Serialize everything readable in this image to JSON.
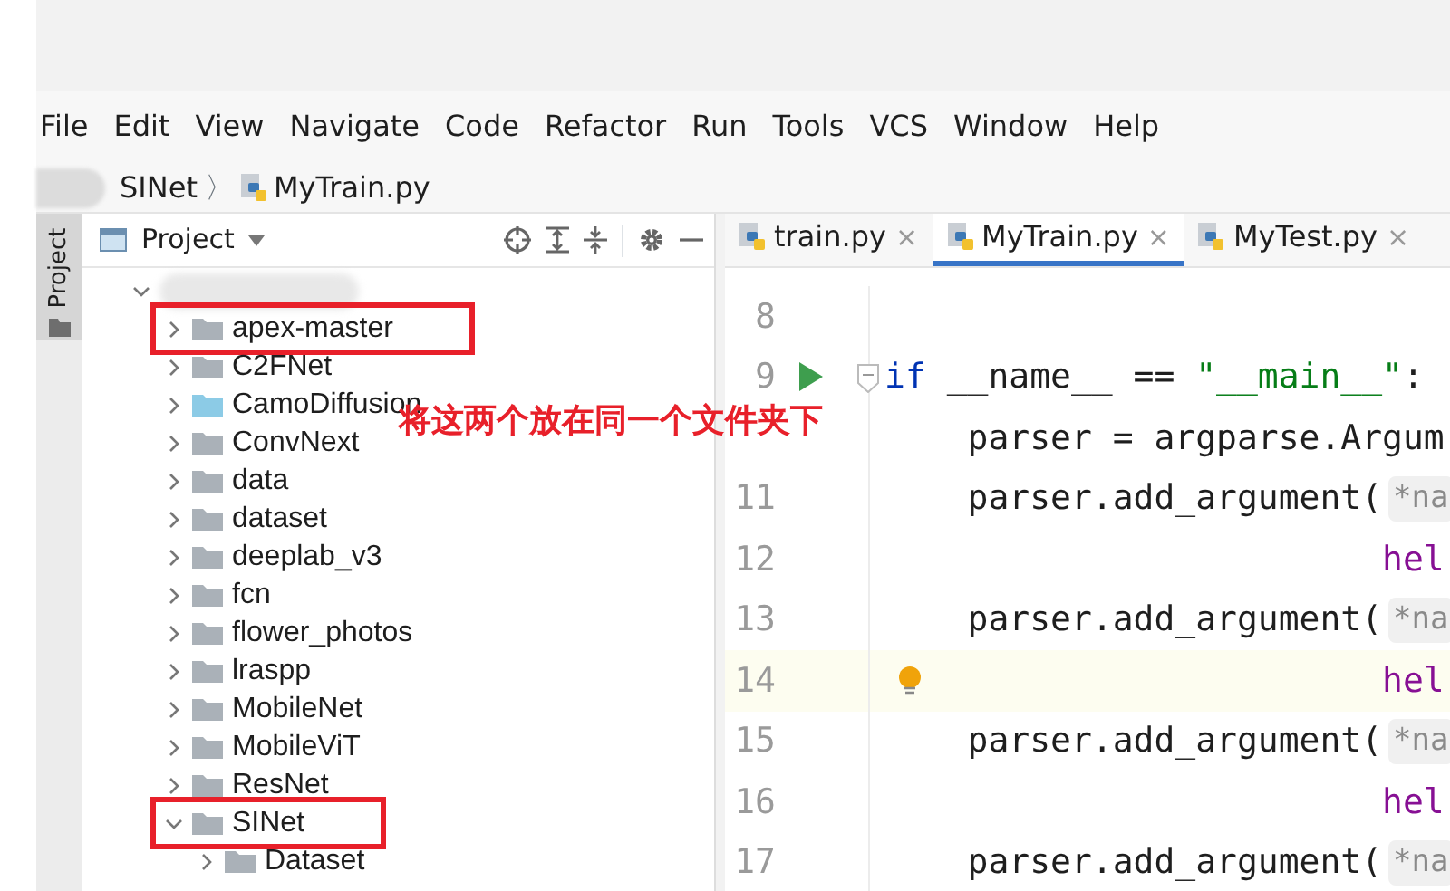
{
  "menu": [
    "File",
    "Edit",
    "View",
    "Navigate",
    "Code",
    "Refactor",
    "Run",
    "Tools",
    "VCS",
    "Window",
    "Help"
  ],
  "breadcrumb": {
    "folder": "SINet",
    "separator": "〉",
    "file": "MyTrain.py"
  },
  "side_strip": {
    "label": "Project"
  },
  "project_panel": {
    "title": "Project",
    "tree": {
      "expanded": true,
      "children": [
        {
          "name": "apex-master",
          "kind": "folder",
          "expanded": false,
          "highlighted": true
        },
        {
          "name": "C2FNet",
          "kind": "folder",
          "expanded": false,
          "highlighted": false
        },
        {
          "name": "CamoDiffusion",
          "kind": "source",
          "expanded": false,
          "highlighted": false
        },
        {
          "name": "ConvNext",
          "kind": "folder",
          "expanded": false,
          "highlighted": false
        },
        {
          "name": "data",
          "kind": "folder",
          "expanded": false,
          "highlighted": false
        },
        {
          "name": "dataset",
          "kind": "folder",
          "expanded": false,
          "highlighted": false
        },
        {
          "name": "deeplab_v3",
          "kind": "folder",
          "expanded": false,
          "highlighted": false
        },
        {
          "name": "fcn",
          "kind": "folder",
          "expanded": false,
          "highlighted": false
        },
        {
          "name": "flower_photos",
          "kind": "folder",
          "expanded": false,
          "highlighted": false
        },
        {
          "name": "lraspp",
          "kind": "folder",
          "expanded": false,
          "highlighted": false
        },
        {
          "name": "MobileNet",
          "kind": "folder",
          "expanded": false,
          "highlighted": false
        },
        {
          "name": "MobileViT",
          "kind": "folder",
          "expanded": false,
          "highlighted": false
        },
        {
          "name": "ResNet",
          "kind": "folder",
          "expanded": false,
          "highlighted": false
        },
        {
          "name": "SINet",
          "kind": "folder",
          "expanded": true,
          "highlighted": true,
          "children": [
            {
              "name": "Dataset",
              "kind": "folder",
              "expanded": false,
              "highlighted": false
            }
          ]
        }
      ]
    }
  },
  "editor": {
    "tabs": [
      {
        "label": "train.py",
        "close": "×",
        "selected": false
      },
      {
        "label": "MyTrain.py",
        "close": "×",
        "selected": true
      },
      {
        "label": "MyTest.py",
        "close": "×",
        "selected": false
      }
    ],
    "lines": [
      {
        "number": "8",
        "current": false
      },
      {
        "number": "9",
        "current": false,
        "run": true,
        "kind": "top",
        "tokens": [
          {
            "text": "if",
            "kind": "keyword"
          },
          {
            "text": " __name__ == ",
            "kind": "plain"
          },
          {
            "text": "\"__main__\"",
            "kind": "string"
          },
          {
            "text": ":",
            "kind": "plain"
          }
        ]
      },
      {
        "current": false,
        "kind": "body",
        "tokens": [
          {
            "text": "parser = argparse.Argum",
            "kind": "plain"
          }
        ]
      },
      {
        "number": "11",
        "current": false,
        "kind": "body",
        "tokens": [
          {
            "text": "parser.add_argument(",
            "kind": "plain"
          },
          {
            "text": "*na",
            "kind": "hint"
          }
        ]
      },
      {
        "number": "12",
        "current": false,
        "kind": "continuation",
        "tokens": [
          {
            "text": "hel",
            "kind": "param"
          }
        ]
      },
      {
        "number": "13",
        "current": false,
        "kind": "body",
        "tokens": [
          {
            "text": "parser.add_argument(",
            "kind": "plain"
          },
          {
            "text": "*na",
            "kind": "hint"
          }
        ]
      },
      {
        "number": "14",
        "current": true,
        "bulb": true,
        "kind": "continuation",
        "tokens": [
          {
            "text": "hel",
            "kind": "param"
          }
        ]
      },
      {
        "number": "15",
        "current": false,
        "kind": "body",
        "tokens": [
          {
            "text": "parser.add_argument(",
            "kind": "plain"
          },
          {
            "text": "*na",
            "kind": "hint"
          }
        ]
      },
      {
        "number": "16",
        "current": false,
        "kind": "continuation",
        "tokens": [
          {
            "text": "hel",
            "kind": "param"
          }
        ]
      },
      {
        "number": "17",
        "current": false,
        "kind": "body",
        "tokens": [
          {
            "text": "parser.add_argument(",
            "kind": "plain"
          },
          {
            "text": "*na",
            "kind": "hint"
          }
        ]
      }
    ]
  },
  "annotation": {
    "text": "将这两个放在同一个文件夹下"
  }
}
